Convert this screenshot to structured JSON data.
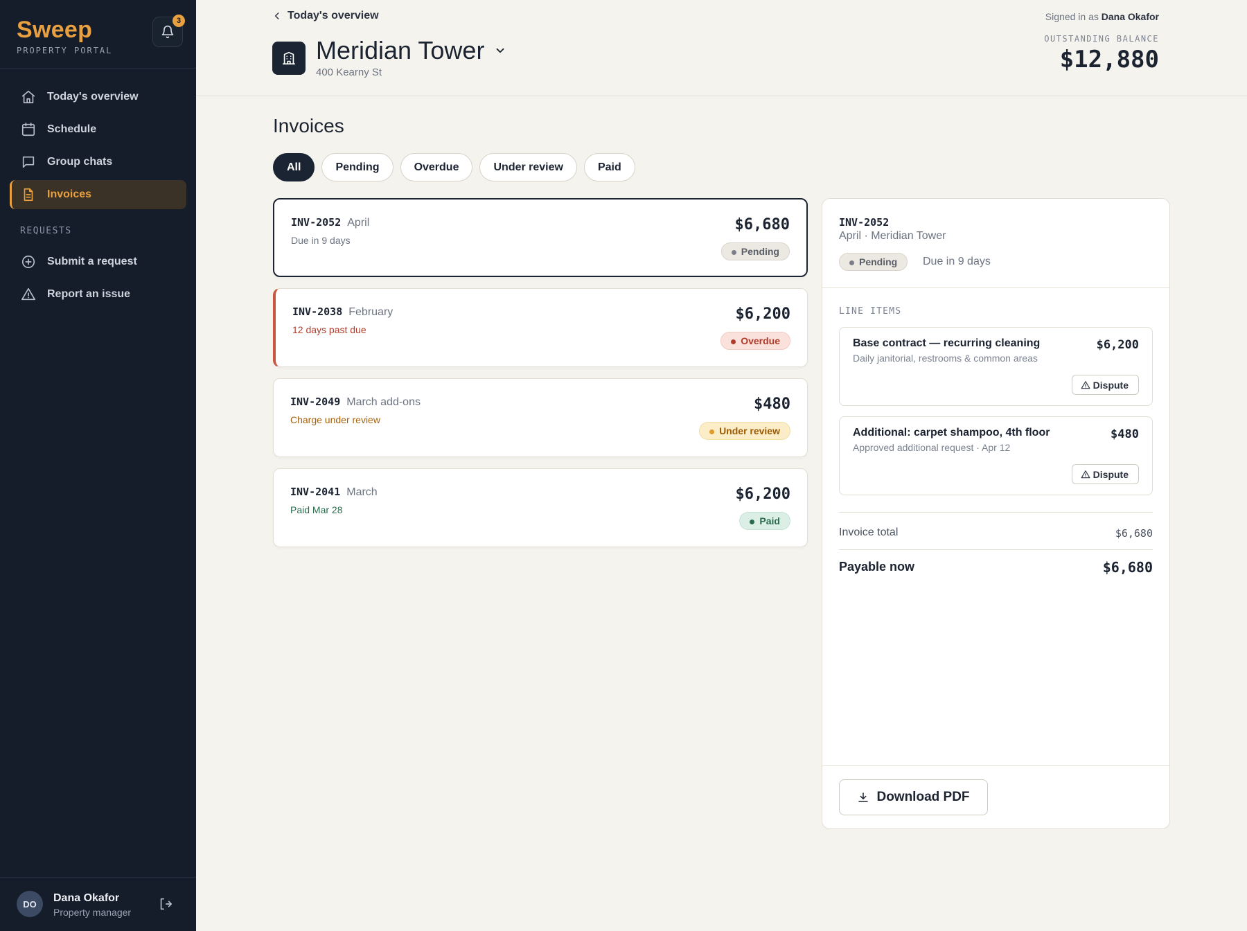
{
  "sidebar": {
    "brand": "Sweep",
    "brand_sub": "PROPERTY PORTAL",
    "notification_count": "3",
    "nav": [
      {
        "label": "Today's overview",
        "icon": "home-icon"
      },
      {
        "label": "Schedule",
        "icon": "calendar-icon"
      },
      {
        "label": "Group chats",
        "icon": "chat-icon"
      },
      {
        "label": "Invoices",
        "icon": "document-icon",
        "active": true
      }
    ],
    "requests_heading": "REQUESTS",
    "requests": [
      {
        "label": "Submit a request",
        "icon": "plus-circle-icon"
      },
      {
        "label": "Report an issue",
        "icon": "warning-icon"
      }
    ],
    "user": {
      "initials": "DO",
      "name": "Dana Okafor",
      "role": "Property manager"
    }
  },
  "header": {
    "back_label": "Today's overview",
    "building_name": "Meridian Tower",
    "building_address": "400 Kearny St",
    "signed_in_prefix": "Signed in as",
    "signed_in_user": "Dana Okafor",
    "balance_label": "OUTSTANDING BALANCE",
    "balance_value": "$12,880"
  },
  "main": {
    "title": "Invoices",
    "filters": [
      "All",
      "Pending",
      "Overdue",
      "Under review",
      "Paid"
    ],
    "active_filter": "All",
    "invoices": [
      {
        "id": "INV-2052",
        "month": "April",
        "sub": "Due in 9 days",
        "amount": "$6,680",
        "status": "Pending"
      },
      {
        "id": "INV-2038",
        "month": "February",
        "sub": "12 days past due",
        "amount": "$6,200",
        "status": "Overdue"
      },
      {
        "id": "INV-2049",
        "month": "March add-ons",
        "sub": "Charge under review",
        "amount": "$480",
        "status": "Under review"
      },
      {
        "id": "INV-2041",
        "month": "March",
        "sub": "Paid Mar 28",
        "amount": "$6,200",
        "status": "Paid"
      }
    ]
  },
  "detail": {
    "id": "INV-2052",
    "subtitle": "April · Meridian Tower",
    "status": "Pending",
    "due": "Due in 9 days",
    "line_items_label": "LINE ITEMS",
    "line_items": [
      {
        "title": "Base contract — recurring cleaning",
        "sub": "Daily janitorial, restrooms & common areas",
        "amount": "$6,200",
        "action": "Dispute"
      },
      {
        "title": "Additional: carpet shampoo, 4th floor",
        "sub": "Approved additional request · Apr 12",
        "amount": "$480",
        "action": "Dispute"
      }
    ],
    "total_label": "Invoice total",
    "total_value": "$6,680",
    "payable_label": "Payable now",
    "payable_value": "$6,680",
    "download_label": "Download PDF"
  },
  "colors": {
    "accent": "#e9a040",
    "sidebar_bg": "#151d2b",
    "overdue": "#c9573f",
    "paid": "#2a6a4d"
  }
}
